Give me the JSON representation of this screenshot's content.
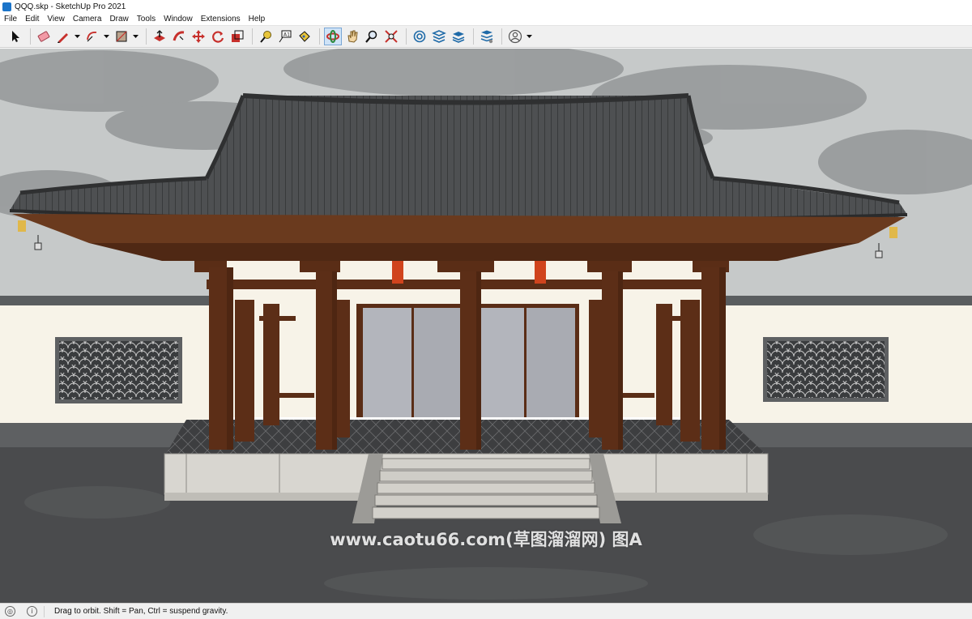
{
  "window": {
    "title": "QQQ.skp - SketchUp Pro 2021"
  },
  "menu": [
    "File",
    "Edit",
    "View",
    "Camera",
    "Draw",
    "Tools",
    "Window",
    "Extensions",
    "Help"
  ],
  "toolbar": {
    "tools": [
      {
        "name": "select-tool",
        "icon": "arrow-cursor-icon"
      },
      {
        "name": "eraser-tool",
        "icon": "eraser-icon"
      },
      {
        "name": "line-tool",
        "icon": "pencil-icon",
        "dropdown": true
      },
      {
        "name": "arc-tool",
        "icon": "arc-icon",
        "dropdown": true
      },
      {
        "name": "shape-tool",
        "icon": "rectangle-icon",
        "dropdown": true
      },
      {
        "name": "push-pull-tool",
        "icon": "push-pull-icon"
      },
      {
        "name": "follow-me-tool",
        "icon": "follow-me-icon"
      },
      {
        "name": "move-tool",
        "icon": "move-icon"
      },
      {
        "name": "rotate-tool",
        "icon": "rotate-icon"
      },
      {
        "name": "scale-tool",
        "icon": "scale-icon"
      },
      {
        "name": "tape-measure-tool",
        "icon": "tape-measure-icon"
      },
      {
        "name": "text-tool",
        "icon": "text-icon"
      },
      {
        "name": "paint-bucket-tool",
        "icon": "paint-bucket-icon"
      },
      {
        "name": "orbit-tool",
        "icon": "orbit-icon",
        "active": true
      },
      {
        "name": "pan-tool",
        "icon": "hand-icon"
      },
      {
        "name": "zoom-tool",
        "icon": "magnifier-icon"
      },
      {
        "name": "zoom-extents-tool",
        "icon": "zoom-extents-icon"
      },
      {
        "name": "3d-warehouse",
        "icon": "warehouse-icon"
      },
      {
        "name": "extension-warehouse",
        "icon": "extension-icon"
      },
      {
        "name": "layout",
        "icon": "layout-icon"
      },
      {
        "name": "extension-manager",
        "icon": "extension-manager-icon"
      },
      {
        "name": "account",
        "icon": "user-icon",
        "dropdown": true
      }
    ]
  },
  "viewport": {
    "scene": "traditional-chinese-gate-hall",
    "colors": {
      "sky": "#c9cccc",
      "cloud": "#8a8d8e",
      "wall": "#f7f3e8",
      "wall_cap": "#5a5d5f",
      "wood": "#5a2d16",
      "roof": "#4b4d4f",
      "pavement": "#4a4b4d",
      "stone": "#d8d6d0",
      "door_glass": "#b3b5bc",
      "accent_red": "#d0441d"
    }
  },
  "watermark": {
    "text": "www.caotu66.com(草图溜溜网) 图A"
  },
  "status": {
    "text": "Drag to orbit. Shift = Pan, Ctrl = suspend gravity.",
    "icons": [
      "geo-location-icon",
      "info-icon"
    ]
  }
}
